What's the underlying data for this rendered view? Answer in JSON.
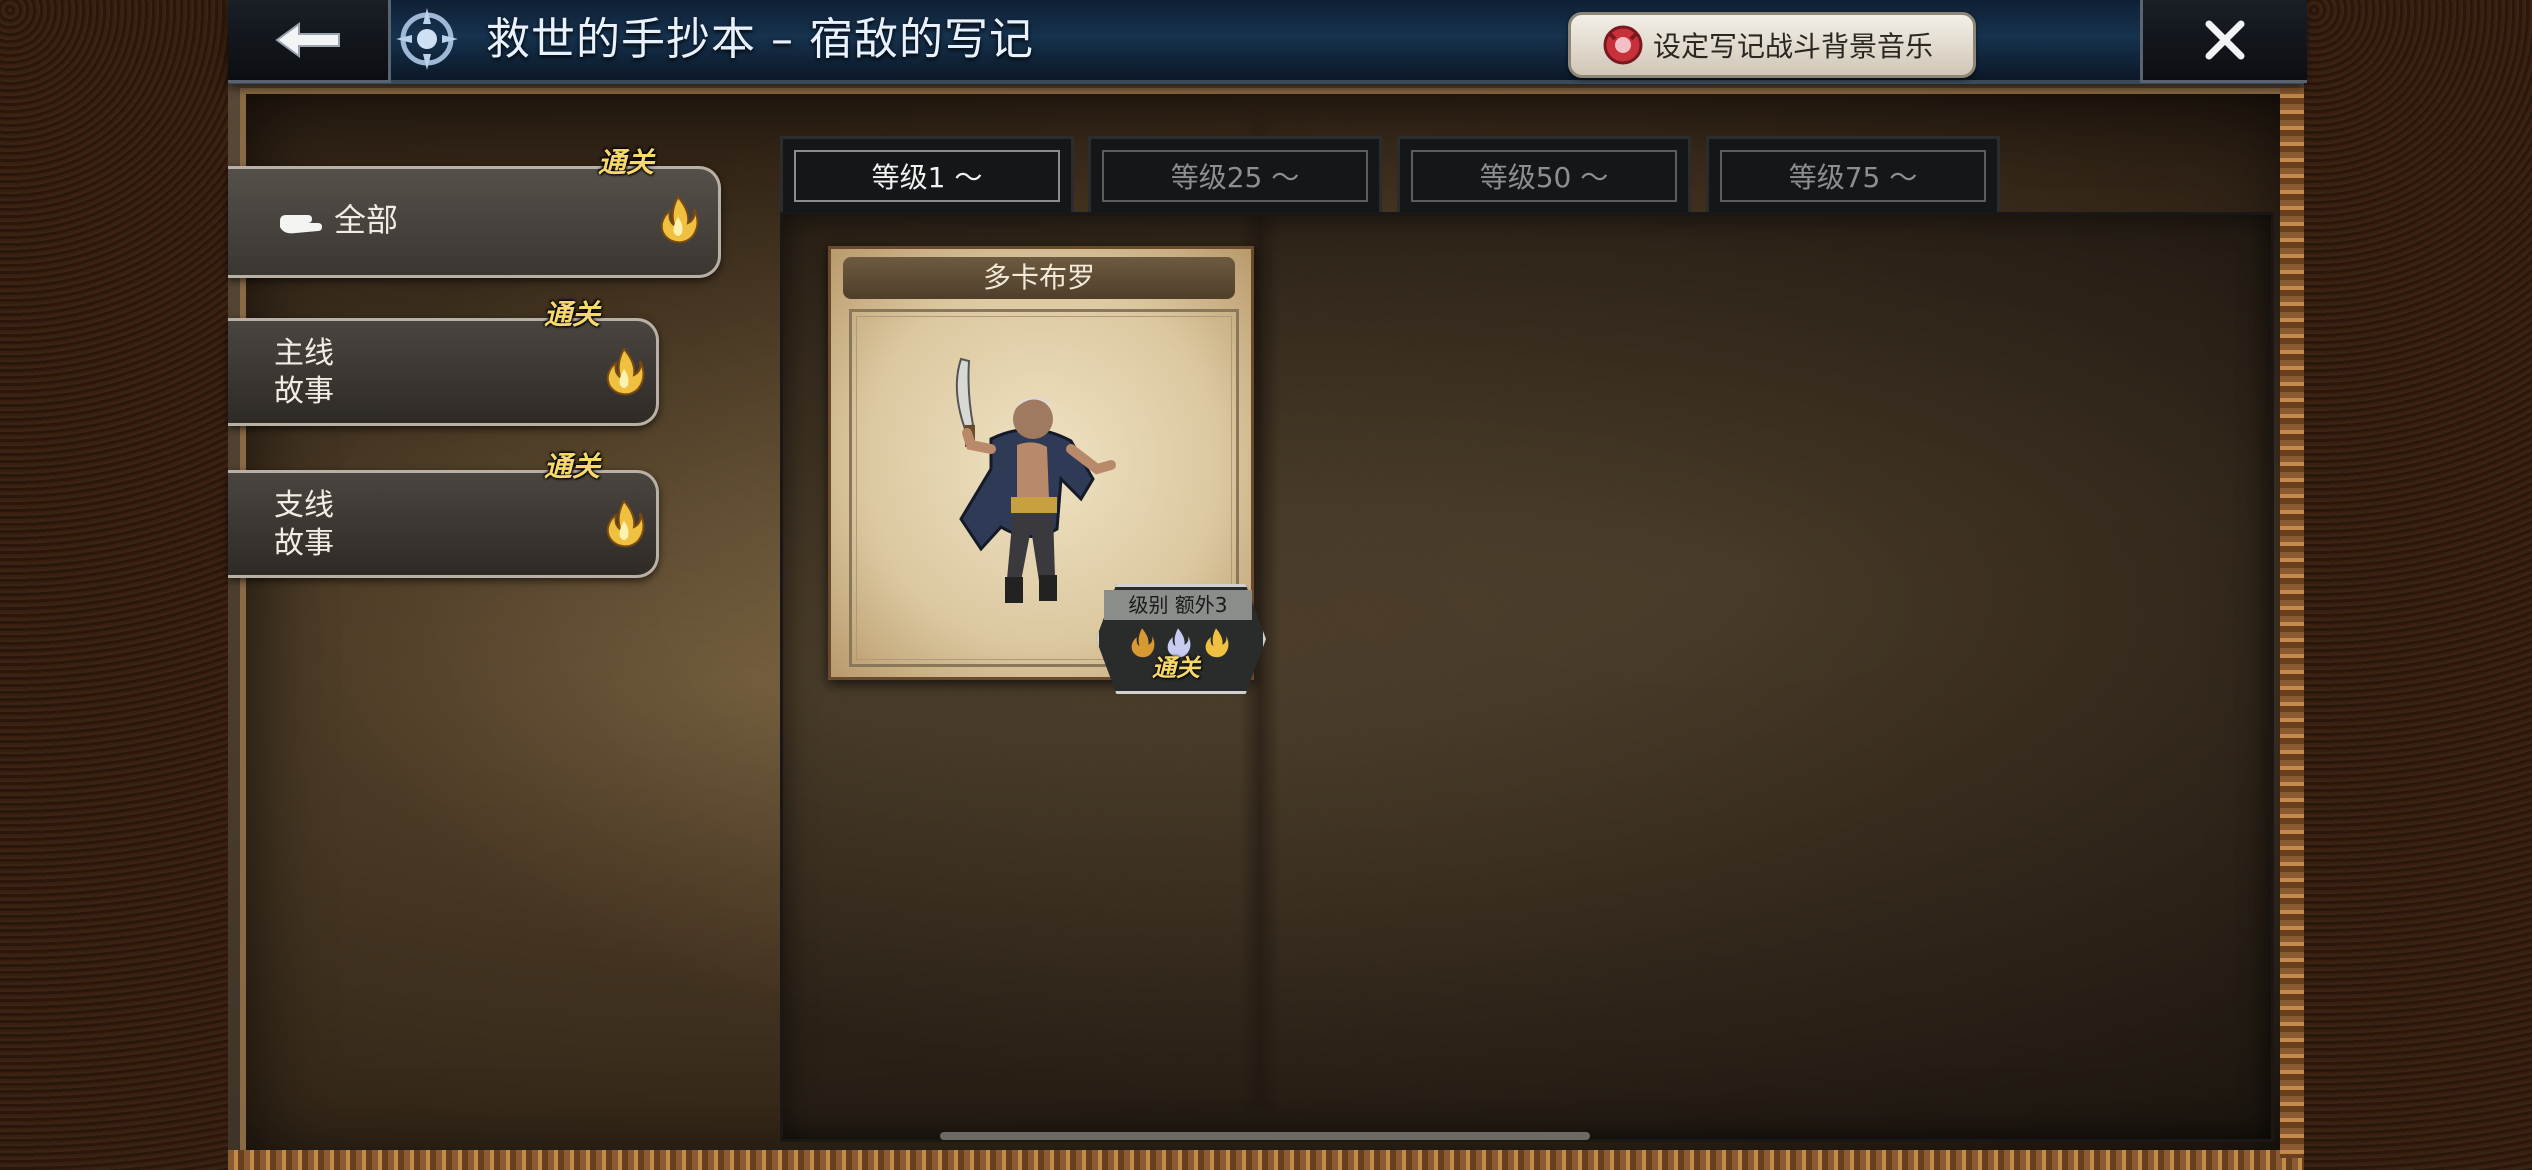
{
  "header": {
    "title": "救世的手抄本 – 宿敌的写记",
    "bgm_button_label": "设定写记战斗背景音乐"
  },
  "sidebar": {
    "items": [
      {
        "label": "全部",
        "badge": "通关",
        "selected": true
      },
      {
        "label_line1": "主线",
        "label_line2": "故事",
        "badge": "通关"
      },
      {
        "label_line1": "支线",
        "label_line2": "故事",
        "badge": "通关"
      }
    ]
  },
  "level_tabs": [
    {
      "label": "等级1 〜",
      "active": true
    },
    {
      "label": "等级25 〜",
      "active": false
    },
    {
      "label": "等级50 〜",
      "active": false
    },
    {
      "label": "等级75 〜",
      "active": false
    }
  ],
  "enemies": [
    {
      "name": "多卡布罗",
      "level_label": "级别 额外3",
      "badge": "通关"
    }
  ],
  "colors": {
    "title_bar": "#16324e",
    "badge_gold": "#f6d96a",
    "flame_gold": "#f0c040"
  },
  "icons": {
    "back": "arrow-left-icon",
    "close": "close-icon",
    "bgm": "music-emblem-icon",
    "pointer": "hand-pointer-icon",
    "flame": "flame-icon"
  }
}
